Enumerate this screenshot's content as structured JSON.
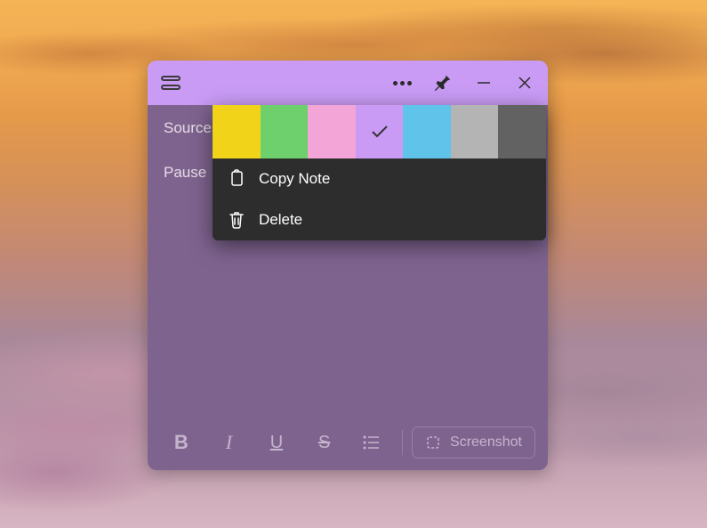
{
  "note": {
    "line1": "Sources",
    "line2": "Pause"
  },
  "toolbar": {
    "bold": "B",
    "italic": "I",
    "underline": "U",
    "strike": "S",
    "screenshot_label": "Screenshot"
  },
  "context_menu": {
    "colors": [
      {
        "name": "yellow",
        "hex": "#f1d41a",
        "selected": false
      },
      {
        "name": "green",
        "hex": "#6dd06d",
        "selected": false
      },
      {
        "name": "pink",
        "hex": "#f2a5d6",
        "selected": false
      },
      {
        "name": "purple",
        "hex": "#c99bf5",
        "selected": true
      },
      {
        "name": "blue",
        "hex": "#5fc3ea",
        "selected": false
      },
      {
        "name": "gray",
        "hex": "#b4b4b4",
        "selected": false
      },
      {
        "name": "dark",
        "hex": "#626262",
        "selected": false
      }
    ],
    "copy_label": "Copy Note",
    "delete_label": "Delete"
  }
}
